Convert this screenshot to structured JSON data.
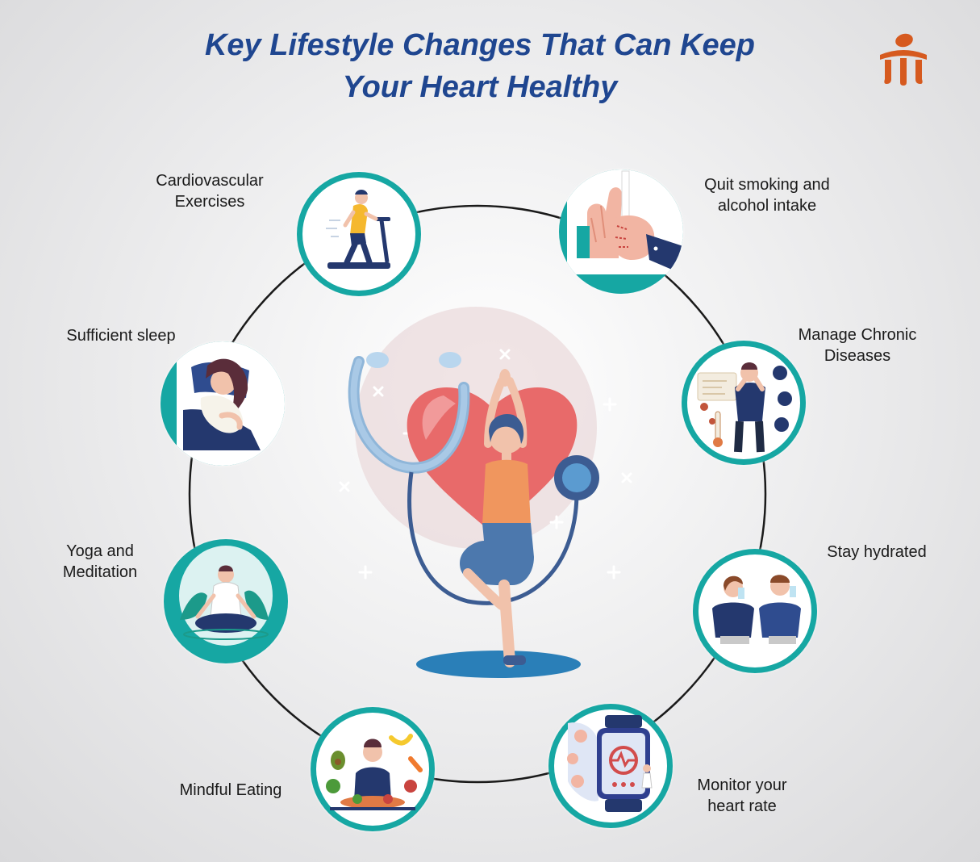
{
  "title": {
    "line1": "Key Lifestyle Changes That Can Keep",
    "line2": "Your Heart Healthy"
  },
  "colors": {
    "title": "#1f4690",
    "teal": "#16a7a3",
    "navy": "#24386e",
    "heart": "#e86a6a",
    "logo": "#d65a1f"
  },
  "items": [
    {
      "id": "cardio",
      "icon": "treadmill-icon",
      "lines": [
        "Cardiovascular",
        "Exercises"
      ]
    },
    {
      "id": "quit",
      "icon": "no-smoking-hand-icon",
      "lines": [
        "Quit smoking and",
        "alcohol intake"
      ]
    },
    {
      "id": "sleep",
      "icon": "sleeping-person-icon",
      "lines": [
        "Sufficient sleep"
      ]
    },
    {
      "id": "chronic",
      "icon": "sick-person-icon",
      "lines": [
        "Manage Chronic",
        "Diseases"
      ]
    },
    {
      "id": "yoga",
      "icon": "meditation-icon",
      "lines": [
        "Yoga and",
        "Meditation"
      ]
    },
    {
      "id": "hydrate",
      "icon": "drinking-water-icon",
      "lines": [
        "Stay hydrated"
      ]
    },
    {
      "id": "eating",
      "icon": "healthy-food-icon",
      "lines": [
        "Mindful Eating"
      ]
    },
    {
      "id": "monitor",
      "icon": "smartwatch-heart-icon",
      "lines": [
        "Monitor your",
        "heart rate"
      ]
    }
  ]
}
